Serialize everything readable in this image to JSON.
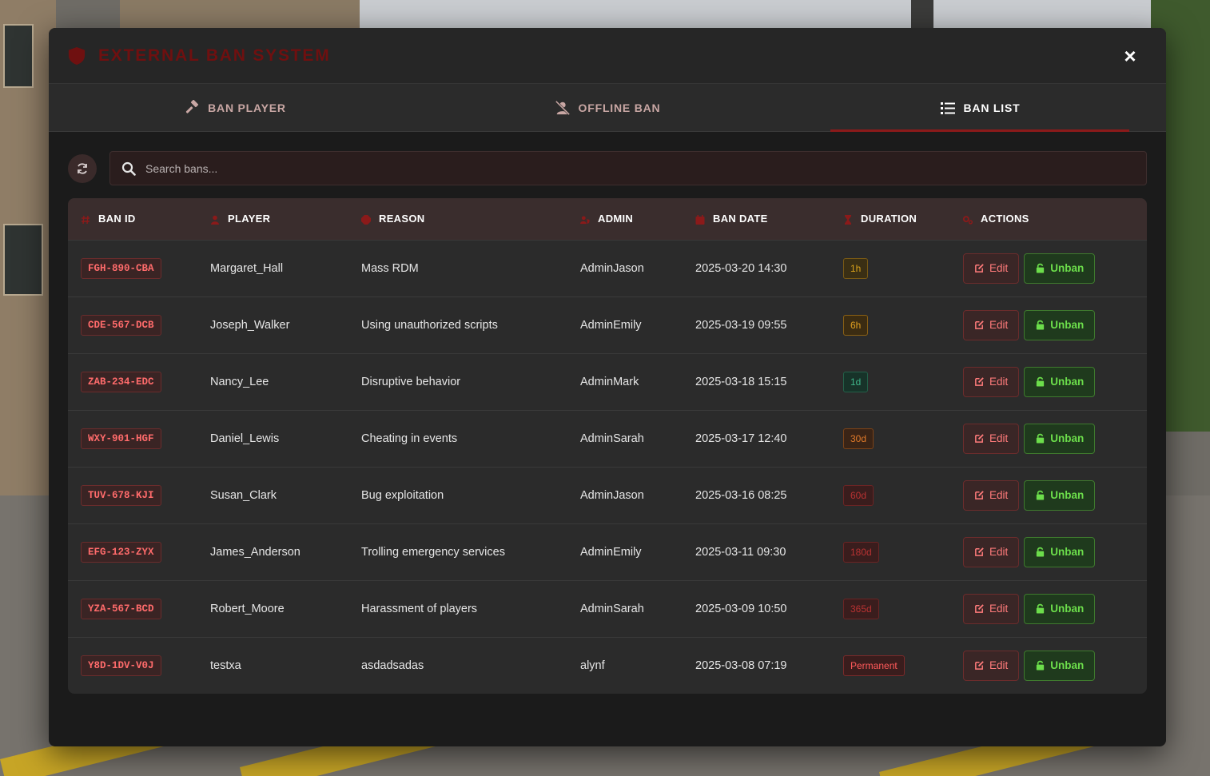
{
  "header": {
    "title": "EXTERNAL BAN SYSTEM",
    "close_label": "×"
  },
  "tabs": [
    {
      "label": "BAN PLAYER",
      "icon": "gavel-icon",
      "active": false
    },
    {
      "label": "OFFLINE BAN",
      "icon": "user-slash-icon",
      "active": false
    },
    {
      "label": "BAN LIST",
      "icon": "list-icon",
      "active": true
    }
  ],
  "search": {
    "placeholder": "Search bans..."
  },
  "table": {
    "columns": [
      {
        "label": "BAN ID",
        "icon": "hash-icon"
      },
      {
        "label": "PLAYER",
        "icon": "user-icon"
      },
      {
        "label": "REASON",
        "icon": "stop-sign-icon"
      },
      {
        "label": "ADMIN",
        "icon": "user-shield-icon"
      },
      {
        "label": "BAN DATE",
        "icon": "calendar-icon"
      },
      {
        "label": "DURATION",
        "icon": "hourglass-icon"
      },
      {
        "label": "ACTIONS",
        "icon": "cogs-icon"
      }
    ],
    "rows": [
      {
        "ban_id": "FGH-890-CBA",
        "player": "Margaret_Hall",
        "reason": "Mass RDM",
        "admin": "AdminJason",
        "date": "2025-03-20 14:30",
        "duration": "1h",
        "edit": "Edit",
        "unban": "Unban"
      },
      {
        "ban_id": "CDE-567-DCB",
        "player": "Joseph_Walker",
        "reason": "Using unauthorized scripts",
        "admin": "AdminEmily",
        "date": "2025-03-19 09:55",
        "duration": "6h",
        "edit": "Edit",
        "unban": "Unban"
      },
      {
        "ban_id": "ZAB-234-EDC",
        "player": "Nancy_Lee",
        "reason": "Disruptive behavior",
        "admin": "AdminMark",
        "date": "2025-03-18 15:15",
        "duration": "1d",
        "edit": "Edit",
        "unban": "Unban"
      },
      {
        "ban_id": "WXY-901-HGF",
        "player": "Daniel_Lewis",
        "reason": "Cheating in events",
        "admin": "AdminSarah",
        "date": "2025-03-17 12:40",
        "duration": "30d",
        "edit": "Edit",
        "unban": "Unban"
      },
      {
        "ban_id": "TUV-678-KJI",
        "player": "Susan_Clark",
        "reason": "Bug exploitation",
        "admin": "AdminJason",
        "date": "2025-03-16 08:25",
        "duration": "60d",
        "edit": "Edit",
        "unban": "Unban"
      },
      {
        "ban_id": "EFG-123-ZYX",
        "player": "James_Anderson",
        "reason": "Trolling emergency services",
        "admin": "AdminEmily",
        "date": "2025-03-11 09:30",
        "duration": "180d",
        "edit": "Edit",
        "unban": "Unban"
      },
      {
        "ban_id": "YZA-567-BCD",
        "player": "Robert_Moore",
        "reason": "Harassment of players",
        "admin": "AdminSarah",
        "date": "2025-03-09 10:50",
        "duration": "365d",
        "edit": "Edit",
        "unban": "Unban"
      },
      {
        "ban_id": "Y8D-1DV-V0J",
        "player": "testxa",
        "reason": "asdadsadas",
        "admin": "alynf",
        "date": "2025-03-08 07:19",
        "duration": "Permanent",
        "edit": "Edit",
        "unban": "Unban"
      }
    ]
  },
  "duration_colors": {
    "1h": {
      "fg": "#d9a21b",
      "bg": "#3a2f14",
      "border": "#7a5a14"
    },
    "6h": {
      "fg": "#e0a020",
      "bg": "#3b2c12",
      "border": "#8a6014"
    },
    "1d": {
      "fg": "#3fb58a",
      "bg": "#173329",
      "border": "#236149"
    },
    "30d": {
      "fg": "#e07a2a",
      "bg": "#3a2416",
      "border": "#7d4317"
    },
    "60d": {
      "fg": "#b83232",
      "bg": "#3a1d1d",
      "border": "#6b2424"
    },
    "180d": {
      "fg": "#b83232",
      "bg": "#3a1d1d",
      "border": "#6b2424"
    },
    "365d": {
      "fg": "#b83232",
      "bg": "#3a1d1d",
      "border": "#6b2424"
    },
    "Permanent": {
      "fg": "#ff5a5a",
      "bg": "#3a1d1d",
      "border": "#7a2a2a"
    }
  },
  "colors": {
    "accent": "#8b1a1a",
    "success": "#6cde4b",
    "danger": "#ff6b6b"
  }
}
